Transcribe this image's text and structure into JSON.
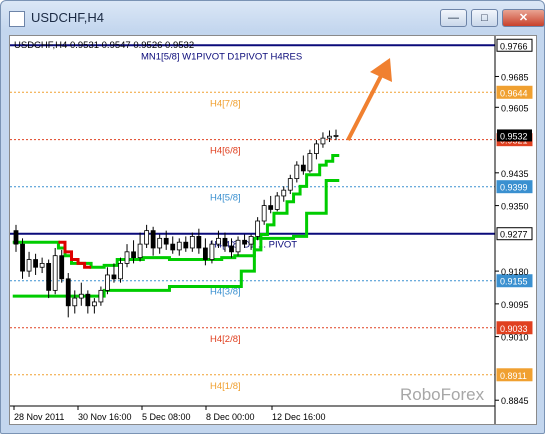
{
  "window": {
    "title": "USDCHF,H4",
    "buttons": {
      "minimize": "—",
      "maximize": "□",
      "close": "✕"
    }
  },
  "chart_data": {
    "type": "candlestick",
    "symbol_line": "USDCHF,H4  0.9531 0.9547 0.9526 0.9532",
    "watermark": "RoboForex",
    "x_ticks": [
      "28 Nov 2011",
      "30 Nov 16:00",
      "5 Dec 08:00",
      "8 Dec 00:00",
      "12 Dec 16:00"
    ],
    "y_ticks": [
      0.9685,
      0.9605,
      0.9435,
      0.935,
      0.918,
      0.9095,
      0.901,
      0.8845
    ],
    "ylim": [
      0.883,
      0.979
    ],
    "levels": [
      {
        "label": "MN1[5/8] W1PIVOT D1PIVOT H4RES",
        "value": 0.9766,
        "color": "#0a0a7a",
        "style": "solid",
        "badge_bg": "#ffffff",
        "badge_fg": "#000000"
      },
      {
        "label": "H4[7/8]",
        "value": 0.9644,
        "color": "#f0a030",
        "style": "dotted",
        "badge_bg": "#f0a030",
        "badge_fg": "#ffffff"
      },
      {
        "label": "H4[6/8]",
        "value": 0.9521,
        "color": "#e04020",
        "style": "dotted",
        "badge_bg": "#e04020",
        "badge_fg": "#ffffff"
      },
      {
        "label": "H4[5/8]",
        "value": 0.9399,
        "color": "#3a90d0",
        "style": "dotted",
        "badge_bg": "#3a90d0",
        "badge_fg": "#ffffff"
      },
      {
        "label": "H4[4/8] D1 ... PIVOT",
        "value": 0.9277,
        "color": "#0a0a7a",
        "style": "solid",
        "badge_bg": "#ffffff",
        "badge_fg": "#000000"
      },
      {
        "label": "H4[3/8]",
        "value": 0.9155,
        "color": "#3a90d0",
        "style": "dotted",
        "badge_bg": "#3a90d0",
        "badge_fg": "#ffffff"
      },
      {
        "label": "H4[2/8]",
        "value": 0.9033,
        "color": "#e04020",
        "style": "dotted",
        "badge_bg": "#e04020",
        "badge_fg": "#ffffff"
      },
      {
        "label": "H4[1/8]",
        "value": 0.8911,
        "color": "#f0a030",
        "style": "dotted",
        "badge_bg": "#f0a030",
        "badge_fg": "#ffffff"
      }
    ],
    "current_price": 0.9532,
    "candles": [
      [
        0.9285,
        0.93,
        0.923,
        0.925
      ],
      [
        0.925,
        0.9265,
        0.916,
        0.918
      ],
      [
        0.918,
        0.923,
        0.9165,
        0.921
      ],
      [
        0.921,
        0.9225,
        0.917,
        0.919
      ],
      [
        0.919,
        0.9215,
        0.9175,
        0.92
      ],
      [
        0.92,
        0.921,
        0.911,
        0.913
      ],
      [
        0.913,
        0.924,
        0.912,
        0.922
      ],
      [
        0.922,
        0.9235,
        0.915,
        0.916
      ],
      [
        0.916,
        0.9175,
        0.906,
        0.909
      ],
      [
        0.909,
        0.913,
        0.907,
        0.911
      ],
      [
        0.911,
        0.915,
        0.909,
        0.912
      ],
      [
        0.912,
        0.913,
        0.907,
        0.909
      ],
      [
        0.909,
        0.911,
        0.907,
        0.91
      ],
      [
        0.91,
        0.914,
        0.909,
        0.913
      ],
      [
        0.913,
        0.919,
        0.912,
        0.917
      ],
      [
        0.917,
        0.92,
        0.915,
        0.916
      ],
      [
        0.916,
        0.9215,
        0.915,
        0.92
      ],
      [
        0.92,
        0.925,
        0.919,
        0.923
      ],
      [
        0.923,
        0.926,
        0.92,
        0.9215
      ],
      [
        0.9215,
        0.928,
        0.9205,
        0.925
      ],
      [
        0.925,
        0.93,
        0.924,
        0.9285
      ],
      [
        0.9285,
        0.9295,
        0.922,
        0.924
      ],
      [
        0.924,
        0.9275,
        0.9225,
        0.9265
      ],
      [
        0.9265,
        0.9285,
        0.9235,
        0.925
      ],
      [
        0.925,
        0.927,
        0.9225,
        0.9235
      ],
      [
        0.9235,
        0.9265,
        0.922,
        0.9255
      ],
      [
        0.9255,
        0.927,
        0.923,
        0.924
      ],
      [
        0.924,
        0.928,
        0.923,
        0.927
      ],
      [
        0.927,
        0.929,
        0.9225,
        0.924
      ],
      [
        0.924,
        0.9265,
        0.9195,
        0.921
      ],
      [
        0.921,
        0.926,
        0.92,
        0.925
      ],
      [
        0.925,
        0.9285,
        0.924,
        0.9265
      ],
      [
        0.9265,
        0.928,
        0.923,
        0.9245
      ],
      [
        0.9245,
        0.9265,
        0.9215,
        0.923
      ],
      [
        0.923,
        0.927,
        0.922,
        0.926
      ],
      [
        0.926,
        0.9275,
        0.924,
        0.925
      ],
      [
        0.925,
        0.9275,
        0.9235,
        0.927
      ],
      [
        0.927,
        0.932,
        0.926,
        0.931
      ],
      [
        0.931,
        0.9365,
        0.93,
        0.935
      ],
      [
        0.935,
        0.9375,
        0.933,
        0.934
      ],
      [
        0.934,
        0.9385,
        0.9335,
        0.9375
      ],
      [
        0.9375,
        0.94,
        0.936,
        0.939
      ],
      [
        0.939,
        0.943,
        0.938,
        0.942
      ],
      [
        0.942,
        0.9465,
        0.941,
        0.9455
      ],
      [
        0.9455,
        0.948,
        0.943,
        0.944
      ],
      [
        0.944,
        0.9495,
        0.9435,
        0.9485
      ],
      [
        0.9485,
        0.952,
        0.947,
        0.951
      ],
      [
        0.951,
        0.954,
        0.95,
        0.9525
      ],
      [
        0.9525,
        0.9545,
        0.9515,
        0.953
      ],
      [
        0.953,
        0.9547,
        0.952,
        0.9532
      ]
    ],
    "indicator_series": [
      {
        "color": "#00cc00",
        "values": [
          0.9115,
          0.9115,
          0.9115,
          0.9115,
          0.9115,
          0.9115,
          0.9115,
          0.9115,
          0.9115,
          0.9115,
          0.9115,
          0.9115,
          0.9115,
          0.9115,
          0.913,
          0.913,
          0.913,
          0.913,
          0.913,
          0.913,
          0.913,
          0.913,
          0.913,
          0.913,
          0.914,
          0.914,
          0.914,
          0.914,
          0.914,
          0.914,
          0.914,
          0.914,
          0.914,
          0.914,
          0.914,
          0.918,
          0.918,
          0.9265,
          0.9265,
          0.9265,
          0.9265,
          0.9265,
          0.9265,
          0.927,
          0.927,
          0.933,
          0.933,
          0.933,
          0.9415,
          0.9415
        ]
      },
      {
        "color": "#00cc00",
        "values": [
          0.9255,
          0.9255,
          0.9255,
          0.9255,
          0.9255,
          0.9255,
          0.9255,
          0.924,
          0.922,
          0.92,
          0.92,
          0.92,
          0.919,
          0.919,
          0.9195,
          0.9195,
          0.921,
          0.921,
          0.921,
          0.921,
          0.9215,
          0.9215,
          0.9215,
          0.9215,
          0.921,
          0.921,
          0.921,
          0.921,
          0.921,
          0.921,
          0.921,
          0.921,
          0.9215,
          0.9215,
          0.922,
          0.922,
          0.922,
          0.9235,
          0.9275,
          0.93,
          0.933,
          0.933,
          0.936,
          0.938,
          0.94,
          0.943,
          0.943,
          0.9455,
          0.9465,
          0.948
        ]
      },
      {
        "color": "#dd0000",
        "values": [
          null,
          null,
          null,
          null,
          null,
          null,
          null,
          0.9255,
          0.923,
          0.921,
          0.92,
          0.919,
          null,
          null,
          null,
          null,
          null,
          null,
          null,
          null,
          null,
          null,
          null,
          null,
          null,
          null,
          null,
          null,
          null,
          null,
          null,
          null,
          null,
          null,
          null,
          null,
          null,
          null,
          null,
          null,
          null,
          null,
          null,
          null,
          null,
          null,
          null,
          null,
          null,
          null
        ]
      }
    ]
  }
}
